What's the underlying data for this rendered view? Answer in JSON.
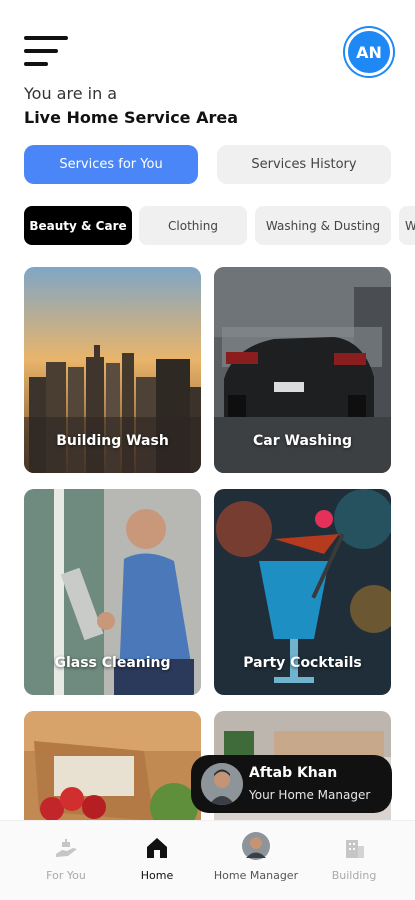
{
  "header": {
    "menu_icon": "hamburger-menu-icon",
    "avatar_initials": "AN",
    "accent_color": "#1e88f5",
    "greeting": "You are in a",
    "area": "Live Home Service Area"
  },
  "segments": [
    {
      "label": "Services for You",
      "active": true
    },
    {
      "label": "Services History",
      "active": false
    }
  ],
  "categories": [
    {
      "label": "Beauty & Care",
      "active": true
    },
    {
      "label": "Clothing",
      "active": false
    },
    {
      "label": "Washing & Dusting",
      "active": false
    },
    {
      "label": "W",
      "active": false
    }
  ],
  "services": [
    {
      "label": "Building Wash"
    },
    {
      "label": "Car Washing"
    },
    {
      "label": "Glass Cleaning"
    },
    {
      "label": "Party Cocktails"
    },
    {
      "label": ""
    },
    {
      "label": ""
    }
  ],
  "manager": {
    "name": "Aftab Khan",
    "role": "Your Home Manager"
  },
  "bottom_nav": [
    {
      "label": "For You",
      "icon": "hand-service-icon"
    },
    {
      "label": "Home",
      "icon": "home-icon",
      "active": true
    },
    {
      "label": "Home Manager",
      "icon": "manager-avatar-icon"
    },
    {
      "label": "Building",
      "icon": "building-icon"
    }
  ]
}
